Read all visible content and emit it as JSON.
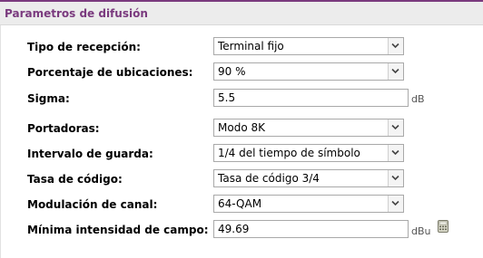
{
  "header": {
    "title": "Parametros de difusión"
  },
  "fields": {
    "tipo_recepcion": {
      "label": "Tipo de recepción:",
      "value": "Terminal fijo"
    },
    "porcentaje_ubicaciones": {
      "label": "Porcentaje de ubicaciones:",
      "value": "90 %"
    },
    "sigma": {
      "label": "Sigma:",
      "value": "5.5",
      "unit": "dB"
    },
    "portadoras": {
      "label": "Portadoras:",
      "value": "Modo 8K"
    },
    "intervalo_guarda": {
      "label": "Intervalo de guarda:",
      "value": "1/4 del tiempo de símbolo"
    },
    "tasa_codigo": {
      "label": "Tasa de código:",
      "value": "Tasa de código 3/4"
    },
    "modulacion_canal": {
      "label": "Modulación de canal:",
      "value": "64-QAM"
    },
    "minima_intensidad": {
      "label": "Mínima intensidad de campo:",
      "value": "49.69",
      "unit": "dBu"
    }
  },
  "icons": {
    "dropdown": "chevron-down-icon",
    "calculator": "calculator-icon"
  },
  "colors": {
    "accent": "#7a3a7e",
    "header_bg": "#ececec"
  }
}
